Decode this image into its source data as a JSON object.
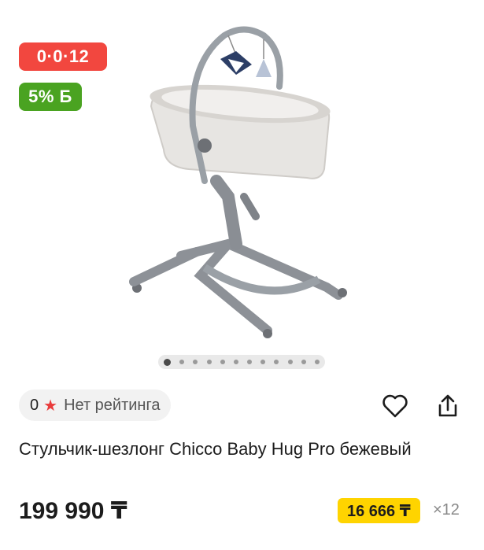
{
  "badges": {
    "installment": "0·0·12",
    "bonus": "5% Б"
  },
  "gallery": {
    "image_icon": "baby-bassinet-chair-image",
    "dot_count": 12,
    "active_index": 0
  },
  "rating": {
    "count": "0",
    "label": "Нет рейтинга"
  },
  "actions": {
    "favorite_icon": "heart-icon",
    "share_icon": "share-icon"
  },
  "product": {
    "title": "Стульчик-шезлонг Chicco Baby Hug Pro бежевый",
    "price": "199 990 ₸",
    "monthly_payment": "16 666 ₸",
    "months": "×12"
  },
  "colors": {
    "installment_badge": "#f2473f",
    "bonus_badge": "#4aa321",
    "monthly_highlight": "#ffd400",
    "star": "#e93b3b"
  }
}
